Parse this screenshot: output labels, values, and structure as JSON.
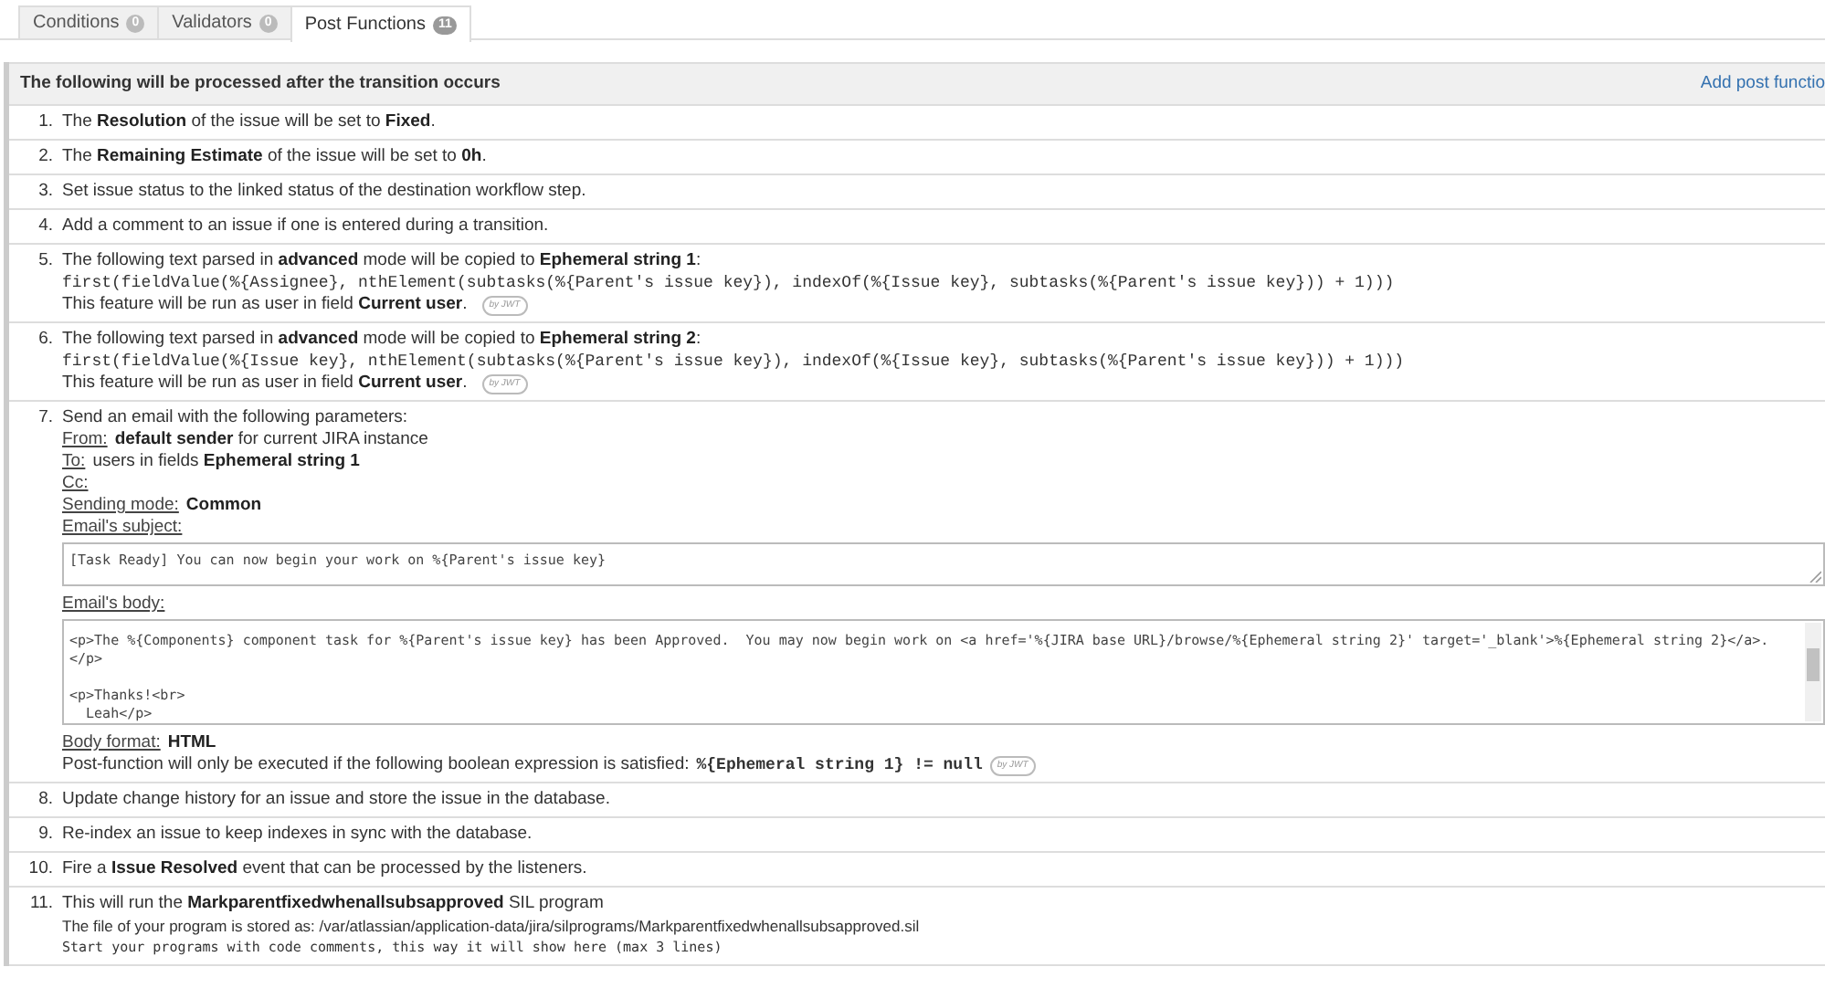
{
  "tabs": [
    {
      "label": "Conditions",
      "count": "0",
      "selected": false
    },
    {
      "label": "Validators",
      "count": "0",
      "selected": false
    },
    {
      "label": "Post Functions",
      "count": "11",
      "selected": true
    }
  ],
  "panel": {
    "title": "The following will be processed after the transition occurs",
    "action": "Add post functio"
  },
  "items": [
    {
      "number": "1.",
      "kind": "text",
      "text": "The **Resolution** of the issue will be set to **Fixed**."
    },
    {
      "number": "2.",
      "kind": "text",
      "text": "The **Remaining Estimate** of the issue will be set to **0h**."
    },
    {
      "number": "3.",
      "kind": "text",
      "text": "Set issue status to the linked status of the destination workflow step."
    },
    {
      "number": "4.",
      "kind": "text",
      "text": "Add a comment to an issue if one is entered during a transition."
    },
    {
      "number": "5.",
      "kind": "parsed",
      "text": "The following text parsed in **advanced** mode will be copied to **Ephemeral string 1**:",
      "code": "first(fieldValue(%{Assignee}, nthElement(subtasks(%{Parent's issue key}), indexOf(%{Issue key}, subtasks(%{Parent's issue key})) + 1)))",
      "note": "This feature will be run as user in field **Current user**.",
      "badge": "by JWT"
    },
    {
      "number": "6.",
      "kind": "parsed",
      "text": "The following text parsed in **advanced** mode will be copied to **Ephemeral string 2**:",
      "code": "first(fieldValue(%{Issue key}, nthElement(subtasks(%{Parent's issue key}), indexOf(%{Issue key}, subtasks(%{Parent's issue key})) + 1)))",
      "note": "This feature will be run as user in field **Current user**.",
      "badge": "by JWT"
    },
    {
      "number": "7.",
      "kind": "email",
      "text": "Send an email with the following parameters:",
      "fields": [
        {
          "label": "From:",
          "value": "**default sender** for current JIRA instance"
        },
        {
          "label": "To:",
          "value": "users in fields **Ephemeral string 1**"
        },
        {
          "label": "Cc:"
        },
        {
          "label": "Sending mode:",
          "value": "**Common**"
        }
      ],
      "subject_label": "Email's subject:",
      "subject": "[Task Ready] You can now begin your work on %{Parent's issue key}",
      "body_label": "Email's body:",
      "body": "<p>The %{Components} component task for %{Parent's issue key} has been Approved.  You may now begin work on <a href='%{JIRA base URL}/browse/%{Ephemeral string 2}' target='_blank'>%{Ephemeral string 2}</a>.\n</p>\n\n<p>Thanks!<br>\n  Leah</p>",
      "format_label": "Body format:",
      "format": "HTML",
      "condition": "Post-function will only be executed if the following boolean expression is satisfied:",
      "condition_code": "%{Ephemeral string 1} != null",
      "badge": "by JWT"
    },
    {
      "number": "8.",
      "kind": "text",
      "text": "Update change history for an issue and store the issue in the database."
    },
    {
      "number": "9.",
      "kind": "text",
      "text": "Re-index an issue to keep indexes in sync with the database."
    },
    {
      "number": "10.",
      "kind": "text",
      "text": "Fire a **Issue Resolved** event that can be processed by the listeners."
    },
    {
      "number": "11.",
      "kind": "sil",
      "text": "This will run the **Markparentfixedwhenallsubsapproved** SIL program",
      "file": "The file of your program is stored as: /var/atlassian/application-data/jira/silprograms/Markparentfixedwhenallsubsapproved.sil",
      "comment": "Start your programs with code comments, this way it will show here (max 3 lines)"
    }
  ]
}
